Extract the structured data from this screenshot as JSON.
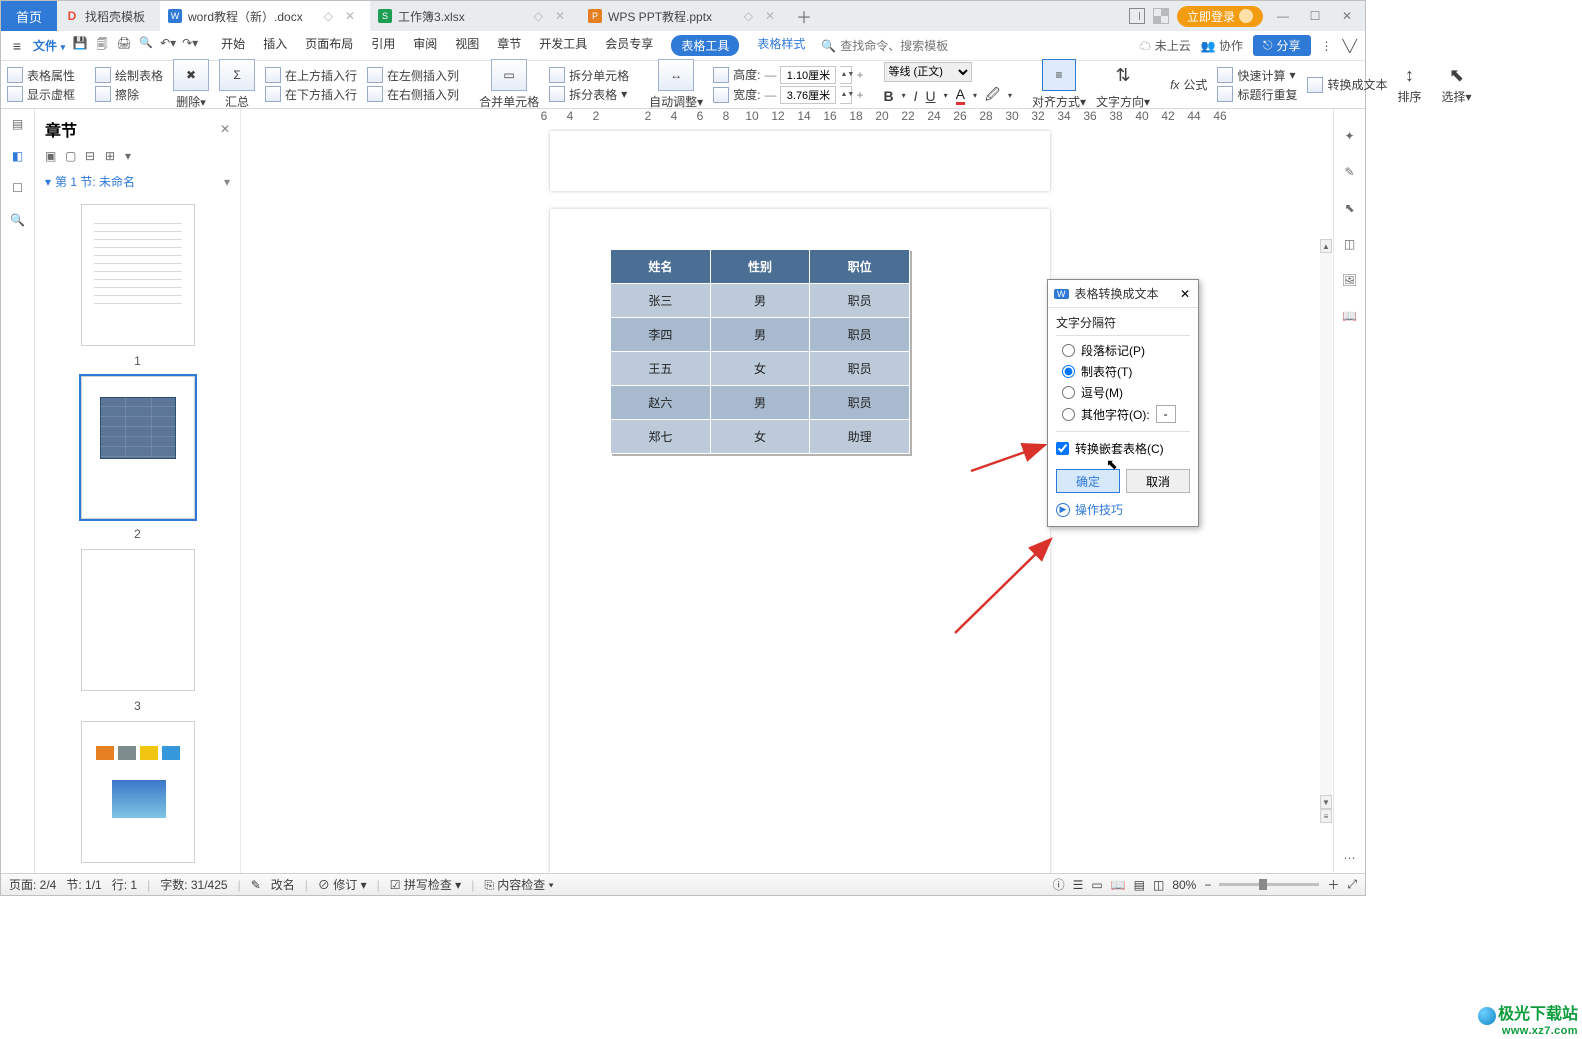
{
  "tabs": {
    "home": "首页",
    "t1": "找稻壳模板",
    "t2": "word教程（新）.docx",
    "t3": "工作簿3.xlsx",
    "t4": "WPS PPT教程.pptx"
  },
  "login": "立即登录",
  "menu": {
    "file": "文件",
    "items": [
      "开始",
      "插入",
      "页面布局",
      "引用",
      "审阅",
      "视图",
      "章节",
      "开发工具",
      "会员专享"
    ],
    "pill": "表格工具",
    "linklike": "表格样式",
    "search_placeholder": "查找命令、搜索模板",
    "cloud": "未上云",
    "coop": "协作",
    "share": "分享"
  },
  "ribbon": {
    "propsA": "表格属性",
    "propsB": "显示虚框",
    "drawA": "绘制表格",
    "drawB": "擦除",
    "delete": "删除",
    "summary": "汇总",
    "ins1": "在上方插入行",
    "ins2": "在下方插入行",
    "ins3": "在左侧插入列",
    "ins4": "在右侧插入列",
    "merge": "合并单元格",
    "splitA": "拆分单元格",
    "splitB": "拆分表格",
    "autofit": "自动调整",
    "heightL": "高度:",
    "widthL": "宽度:",
    "heightV": "1.10厘米",
    "widthV": "3.76厘米",
    "font": "等线 (正文)",
    "align": "对齐方式",
    "dir": "文字方向",
    "fx": "公式",
    "calc": "快速计算",
    "repeat": "标题行重复",
    "convert": "转换成文本",
    "sort": "排序",
    "select": "选择"
  },
  "h_ruler": [
    "6",
    "4",
    "2",
    " ",
    "2",
    "4",
    "6",
    "8",
    "10",
    "12",
    "14",
    "16",
    "18",
    "20",
    "22",
    "24",
    "26",
    "28",
    "30",
    "32",
    "34",
    "36",
    "38",
    "40",
    "42",
    "44",
    "46"
  ],
  "nav": {
    "title": "章节",
    "item1": "第 1 节: 未命名",
    "pages": [
      "1",
      "2",
      "3"
    ]
  },
  "table": {
    "head": [
      "姓名",
      "性别",
      "职位"
    ],
    "rows": [
      [
        "张三",
        "男",
        "职员"
      ],
      [
        "李四",
        "男",
        "职员"
      ],
      [
        "王五",
        "女",
        "职员"
      ],
      [
        "赵六",
        "男",
        "职员"
      ],
      [
        "郑七",
        "女",
        "助理"
      ]
    ]
  },
  "dialog": {
    "title": "表格转换成文本",
    "group": "文字分隔符",
    "opt1": "段落标记(P)",
    "opt2": "制表符(T)",
    "opt3": "逗号(M)",
    "opt4": "其他字符(O):",
    "opt4val": "-",
    "chk": "转换嵌套表格(C)",
    "ok": "确定",
    "cancel": "取消",
    "tip": "操作技巧"
  },
  "status": {
    "page": "页面: 2/4",
    "sec": "节: 1/1",
    "row": "行: 1",
    "words": "字数: 31/425",
    "rename": "改名",
    "revise": "修订",
    "spell": "拼写检查",
    "content": "内容检查",
    "zoom": "80%"
  },
  "watermark": {
    "a": "极光下载站",
    "b": "www.xz7.com"
  }
}
